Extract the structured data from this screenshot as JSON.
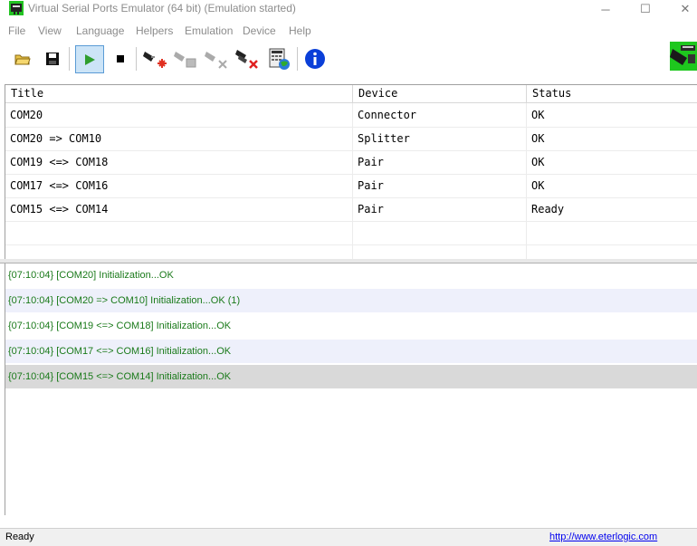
{
  "window": {
    "title": "Virtual Serial Ports Emulator (64 bit) (Emulation started)",
    "minimize": "─",
    "maximize": "☐",
    "close": "✕"
  },
  "menu": [
    "File",
    "View",
    "Language",
    "Helpers",
    "Emulation",
    "Device",
    "Help"
  ],
  "toolbar": {
    "buttons": [
      "open-icon",
      "save-icon",
      "start-emulation-icon",
      "stop-emulation-icon",
      "create-device-icon",
      "edit-device-icon",
      "remove-device-icon",
      "remove-all-devices-icon",
      "device-properties-icon",
      "about-icon"
    ],
    "pressed": "start-emulation-icon"
  },
  "table": {
    "columns": [
      "Title",
      "Device",
      "Status"
    ],
    "rows": [
      {
        "title": "COM20",
        "device": "Connector",
        "status": "OK"
      },
      {
        "title": "COM20 => COM10",
        "device": "Splitter",
        "status": "OK"
      },
      {
        "title": "COM19 <=> COM18",
        "device": "Pair",
        "status": "OK"
      },
      {
        "title": "COM17 <=> COM16",
        "device": "Pair",
        "status": "OK"
      },
      {
        "title": "COM15 <=> COM14",
        "device": "Pair",
        "status": "Ready"
      }
    ]
  },
  "log": [
    "{07:10:04} [COM20] Initialization...OK",
    "{07:10:04} [COM20 => COM10] Initialization...OK (1)",
    "{07:10:04} [COM19 <=> COM18] Initialization...OK",
    "{07:10:04} [COM17 <=> COM16] Initialization...OK",
    "{07:10:04} [COM15 <=> COM14] Initialization...OK"
  ],
  "status_bar": {
    "text": "Ready",
    "link": "http://www.eterlogic.com"
  },
  "colors": {
    "log_text": "#1a7a1a",
    "log_alt_row": "#eef0fb",
    "log_selected_row": "#d9d9d9",
    "play_green": "#2e9e2e"
  }
}
